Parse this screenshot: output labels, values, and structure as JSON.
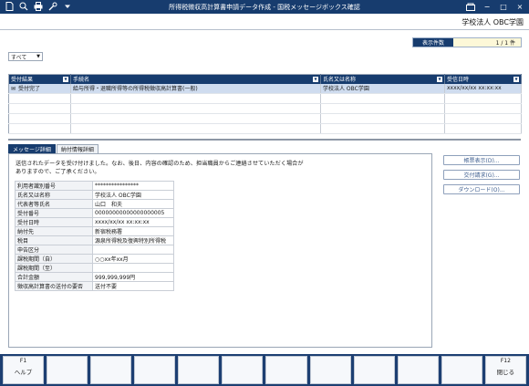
{
  "window": {
    "title": "所得税徴収高計算書申請データ作成 - 国税メッセージボックス確認",
    "controls": {
      "minimize": "−",
      "maximize": "□",
      "close": "×"
    }
  },
  "header": {
    "organization": "学校法人 OBC学園"
  },
  "result_count": {
    "label": "表示件数",
    "value": "1 / 1 件"
  },
  "filter": {
    "selected": "すべて"
  },
  "grid": {
    "columns": [
      "受付結果",
      "手続名",
      "氏名又は名称",
      "受信日時"
    ],
    "rows": [
      [
        "受付完了",
        "給与所得・退職所得等の所得税徴収高計算書(一般)",
        "学校法人 OBC学園",
        "xxxx/xx/xx xx:xx:xx"
      ]
    ]
  },
  "tabs": [
    "メッセージ詳細",
    "納付情報詳細"
  ],
  "message": {
    "line1": "送信されたデータを受け付けました。なお、後日、内容の確認のため、担当職員からご連絡させていただく場合が",
    "line2": "ありますので、ご了承ください。"
  },
  "details": [
    {
      "key": "利用者識別番号",
      "value": "****************"
    },
    {
      "key": "氏名又は名称",
      "value": "学校法人 OBC学園"
    },
    {
      "key": "代表者等氏名",
      "value": "山口　和夫"
    },
    {
      "key": "受付番号",
      "value": "00000000000000000005"
    },
    {
      "key": "受付日時",
      "value": "xxxx/xx/xx xx:xx:xx"
    },
    {
      "key": "納付先",
      "value": "新宿税務署"
    },
    {
      "key": "税目",
      "value": "源泉所得税及復興特別所得税"
    },
    {
      "key": "申告区分",
      "value": ""
    },
    {
      "key": "課税期間（自）",
      "value": "○○xx年xx月"
    },
    {
      "key": "課税期間（至）",
      "value": ""
    },
    {
      "key": "合計金額",
      "value": "999,999,999円"
    },
    {
      "key": "徴収高計算書の送付の要否",
      "value": "送付不要"
    }
  ],
  "side_buttons": [
    "帳票表示(D)...",
    "交付請求(G)...",
    "ダウンロード(O)..."
  ],
  "fkeys": [
    {
      "num": "F1",
      "label": "ヘルプ"
    },
    {
      "num": "",
      "label": ""
    },
    {
      "num": "",
      "label": ""
    },
    {
      "num": "",
      "label": ""
    },
    {
      "num": "",
      "label": ""
    },
    {
      "num": "",
      "label": ""
    },
    {
      "num": "",
      "label": ""
    },
    {
      "num": "",
      "label": ""
    },
    {
      "num": "",
      "label": ""
    },
    {
      "num": "",
      "label": ""
    },
    {
      "num": "",
      "label": ""
    },
    {
      "num": "F12",
      "label": "閉じる"
    }
  ],
  "colors": {
    "accent": "#173c6e",
    "selected_row": "#cfdcef",
    "count_value_bg": "#fdf8d8"
  }
}
